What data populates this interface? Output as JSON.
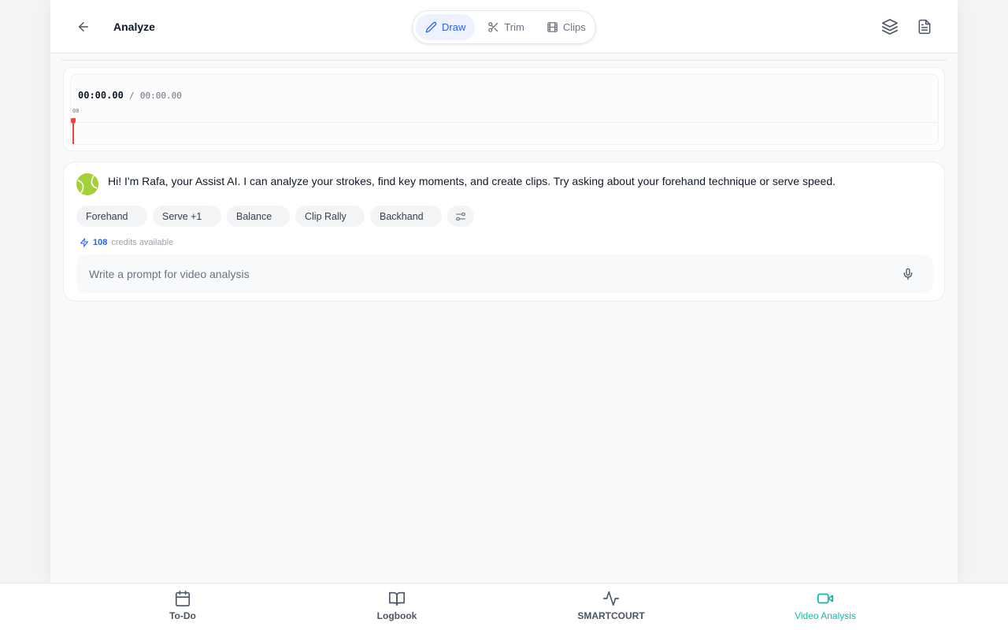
{
  "header": {
    "title": "Analyze",
    "modes": [
      {
        "label": "Draw",
        "icon": "pencil-icon",
        "active": true
      },
      {
        "label": "Trim",
        "icon": "scissors-icon",
        "active": false
      },
      {
        "label": "Clips",
        "icon": "film-icon",
        "active": false
      }
    ],
    "actions": [
      {
        "icon": "layers-icon"
      },
      {
        "icon": "document-icon"
      }
    ]
  },
  "timeline": {
    "current_time": "00:00.00",
    "separator": "/",
    "total_time": "00:00.00",
    "tick_label": "00"
  },
  "chat": {
    "assistant_icon": "tennis-ball-icon",
    "greeting": "Hi! I'm Rafa, your Assist AI. I can analyze your strokes, find key moments, and create clips. Try asking about your forehand technique or serve speed.",
    "chips": [
      "Forehand",
      "Serve +1",
      "Balance",
      "Clip Rally",
      "Backhand"
    ],
    "filter_icon": "sliders-icon",
    "credits_count": "108",
    "credits_label": "credits available",
    "prompt_value": "",
    "prompt_placeholder": "Write a prompt for video analysis",
    "mic_icon": "microphone-icon"
  },
  "bottom_nav": {
    "items": [
      {
        "label": "To-Do",
        "icon": "calendar-icon",
        "active": false
      },
      {
        "label": "Logbook",
        "icon": "book-icon",
        "active": false
      },
      {
        "label": "SMARTCOURT",
        "icon": "activity-icon",
        "active": false
      },
      {
        "label": "Video Analysis",
        "icon": "video-camera-icon",
        "active": true
      }
    ]
  },
  "colors": {
    "accent_blue": "#2563eb",
    "active_teal": "#14b8a6",
    "playhead_red": "#ef4444",
    "tennis_ball": "#a3d13a"
  }
}
